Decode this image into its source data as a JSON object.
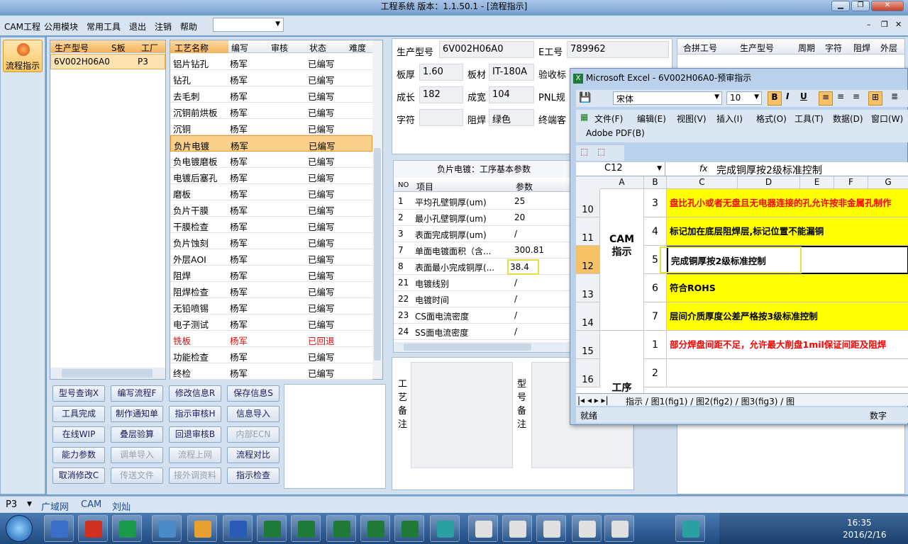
{
  "window": {
    "title": "工程系统 版本：1.1.50.1 - [流程指示]"
  },
  "menu": [
    "CAM工程",
    "公用模块",
    "常用工具",
    "退出",
    "注销",
    "帮助"
  ],
  "sidebar": {
    "label": "流程指示"
  },
  "product_list": {
    "headers": [
      "生产型号",
      "S板",
      "工厂"
    ],
    "rows": [
      {
        "model": "6V002H06A0",
        "s": "",
        "factory": "P3"
      }
    ]
  },
  "process_table": {
    "headers": [
      "工艺名称",
      "编写",
      "审核",
      "状态",
      "难度"
    ],
    "rows": [
      {
        "name": "铝片钻孔",
        "writer": "杨军",
        "review": "",
        "status": "已编写",
        "red": false
      },
      {
        "name": "钻孔",
        "writer": "杨军",
        "review": "",
        "status": "已编写",
        "red": false
      },
      {
        "name": "去毛刺",
        "writer": "杨军",
        "review": "",
        "status": "已编写",
        "red": false
      },
      {
        "name": "沉铜前烘板",
        "writer": "杨军",
        "review": "",
        "status": "已编写",
        "red": false
      },
      {
        "name": "沉铜",
        "writer": "杨军",
        "review": "",
        "status": "已编写",
        "red": false
      },
      {
        "name": "负片电镀",
        "writer": "杨军",
        "review": "",
        "status": "已编写",
        "red": false,
        "selected": true
      },
      {
        "name": "负电镀磨板",
        "writer": "杨军",
        "review": "",
        "status": "已编写",
        "red": false
      },
      {
        "name": "电镀后塞孔",
        "writer": "杨军",
        "review": "",
        "status": "已编写",
        "red": false
      },
      {
        "name": "磨板",
        "writer": "杨军",
        "review": "",
        "status": "已编写",
        "red": false
      },
      {
        "name": "负片干膜",
        "writer": "杨军",
        "review": "",
        "status": "已编写",
        "red": false
      },
      {
        "name": "干膜检查",
        "writer": "杨军",
        "review": "",
        "status": "已编写",
        "red": false
      },
      {
        "name": "负片蚀刻",
        "writer": "杨军",
        "review": "",
        "status": "已编写",
        "red": false
      },
      {
        "name": "外层AOI",
        "writer": "杨军",
        "review": "",
        "status": "已编写",
        "red": false
      },
      {
        "name": "阻焊",
        "writer": "杨军",
        "review": "",
        "status": "已编写",
        "red": false
      },
      {
        "name": "阻焊检查",
        "writer": "杨军",
        "review": "",
        "status": "已编写",
        "red": false
      },
      {
        "name": "无铅喷锡",
        "writer": "杨军",
        "review": "",
        "status": "已编写",
        "red": false
      },
      {
        "name": "电子测试",
        "writer": "杨军",
        "review": "",
        "status": "已编写",
        "red": false
      },
      {
        "name": "铣板",
        "writer": "杨军",
        "review": "",
        "status": "已回退",
        "red": true
      },
      {
        "name": "功能检查",
        "writer": "杨军",
        "review": "",
        "status": "已编写",
        "red": false
      },
      {
        "name": "终检",
        "writer": "杨军",
        "review": "",
        "status": "已编写",
        "red": false
      }
    ]
  },
  "buttons": [
    [
      {
        "label": "型号查询X",
        "dis": false
      },
      {
        "label": "编写流程F",
        "dis": false
      },
      {
        "label": "修改信息R",
        "dis": false
      },
      {
        "label": "保存信息S",
        "dis": false
      }
    ],
    [
      {
        "label": "工具完成",
        "dis": false
      },
      {
        "label": "制作通知单",
        "dis": false
      },
      {
        "label": "指示审核H",
        "dis": false
      },
      {
        "label": "信息导入",
        "dis": false
      }
    ],
    [
      {
        "label": "在线WIP",
        "dis": false
      },
      {
        "label": "叠层验算",
        "dis": false
      },
      {
        "label": "回退审核B",
        "dis": false
      },
      {
        "label": "内部ECN",
        "dis": true
      }
    ],
    [
      {
        "label": "能力参数",
        "dis": false
      },
      {
        "label": "调单导入",
        "dis": true
      },
      {
        "label": "流程上网",
        "dis": true
      },
      {
        "label": "流程对比",
        "dis": false
      }
    ],
    [
      {
        "label": "取消修改C",
        "dis": false
      },
      {
        "label": "传送文件",
        "dis": true
      },
      {
        "label": "接外调资料",
        "dis": true
      },
      {
        "label": "指示检查",
        "dis": false
      }
    ]
  ],
  "info": {
    "model_label": "生产型号",
    "model": "6V002H06A0",
    "eng_label": "E工号",
    "eng": "789962",
    "thick_label": "板厚",
    "thick": "1.60",
    "mat_label": "板材",
    "mat": "IT-180A",
    "accept_label": "验收标",
    "len_label": "成长",
    "len": "182",
    "wid_label": "成宽",
    "wid": "104",
    "pnl_label": "PNL规",
    "char_label": "字符",
    "char": "",
    "mask_label": "阻焊",
    "mask": "绿色",
    "cust_label": "终端客"
  },
  "param_table": {
    "title": "负片电镀：工序基本参数",
    "headers": [
      "NO",
      "项目",
      "参数"
    ],
    "rows": [
      {
        "no": "1",
        "item": "平均孔壁铜厚(um)",
        "val": "25"
      },
      {
        "no": "2",
        "item": "最小孔壁铜厚(um)",
        "val": "20"
      },
      {
        "no": "3",
        "item": "表面完成铜厚(um)",
        "val": "/"
      },
      {
        "no": "7",
        "item": "单面电镀面积（含...",
        "val": "300.81"
      },
      {
        "no": "8",
        "item": "表面最小完成铜厚(...",
        "val": "38.4"
      },
      {
        "no": "21",
        "item": "电镀线别",
        "val": "/"
      },
      {
        "no": "22",
        "item": "电镀时间",
        "val": "/"
      },
      {
        "no": "23",
        "item": "CS面电流密度",
        "val": "/"
      },
      {
        "no": "24",
        "item": "SS面电流密度",
        "val": "/"
      }
    ]
  },
  "notes": {
    "process": "工艺备注",
    "model": "型号备注"
  },
  "right_table": {
    "headers": [
      "合拼工号",
      "生产型号",
      "周期",
      "字符",
      "阻焊",
      "外层"
    ]
  },
  "excel": {
    "title": "Microsoft Excel - 6V002H06A0-预审指示",
    "font": "宋体",
    "size": "10",
    "menu": [
      "文件(F)",
      "编辑(E)",
      "视图(V)",
      "插入(I)",
      "格式(O)",
      "工具(T)",
      "数据(D)",
      "窗口(W)"
    ],
    "menu2": "Adobe PDF(B)",
    "namebox": "C12",
    "formula": "完成铜厚按2级标准控制",
    "cols": [
      "A",
      "B",
      "C",
      "D",
      "E",
      "F",
      "G"
    ],
    "rows": [
      {
        "num": "10",
        "b": "3",
        "c": "盘比孔小或者无盘且无电器连接的孔允许按非金属孔制作",
        "color": "#ff0000",
        "bg": "#ffff00"
      },
      {
        "num": "11",
        "b": "4",
        "c": "标记加在底层阻焊层,标记位置不能漏铜",
        "color": "#000000",
        "bg": "#ffff00"
      },
      {
        "num": "12",
        "b": "5",
        "c": "完成铜厚按2级标准控制",
        "color": "#000000",
        "bg": "#ffffff"
      },
      {
        "num": "13",
        "b": "6",
        "c": "符合ROHS",
        "color": "#000000",
        "bg": "#ffff00"
      },
      {
        "num": "14",
        "b": "7",
        "c": "层间介质厚度公差严格按3级标准控制",
        "color": "#000000",
        "bg": "#ffff00"
      },
      {
        "num": "15",
        "b": "1",
        "c": "部分焊盘间距不足，允许最大削盘1mil保证间距及阻焊",
        "color": "#ff0000",
        "bg": "#ffffff"
      },
      {
        "num": "16",
        "b": "2",
        "c": "",
        "color": "#000000",
        "bg": "#ffffff"
      }
    ],
    "group1": "CAM\n指示",
    "group2": "工序",
    "sheets": "指示 / 图1(fig1) / 图2(fig2) / 图3(fig3) / 图",
    "status": "就绪",
    "status_right": "数字"
  },
  "statusbar": [
    "P3",
    "广域网",
    "CAM",
    "刘灿"
  ],
  "clock": {
    "time": "16:35",
    "date": "2016/2/16"
  }
}
